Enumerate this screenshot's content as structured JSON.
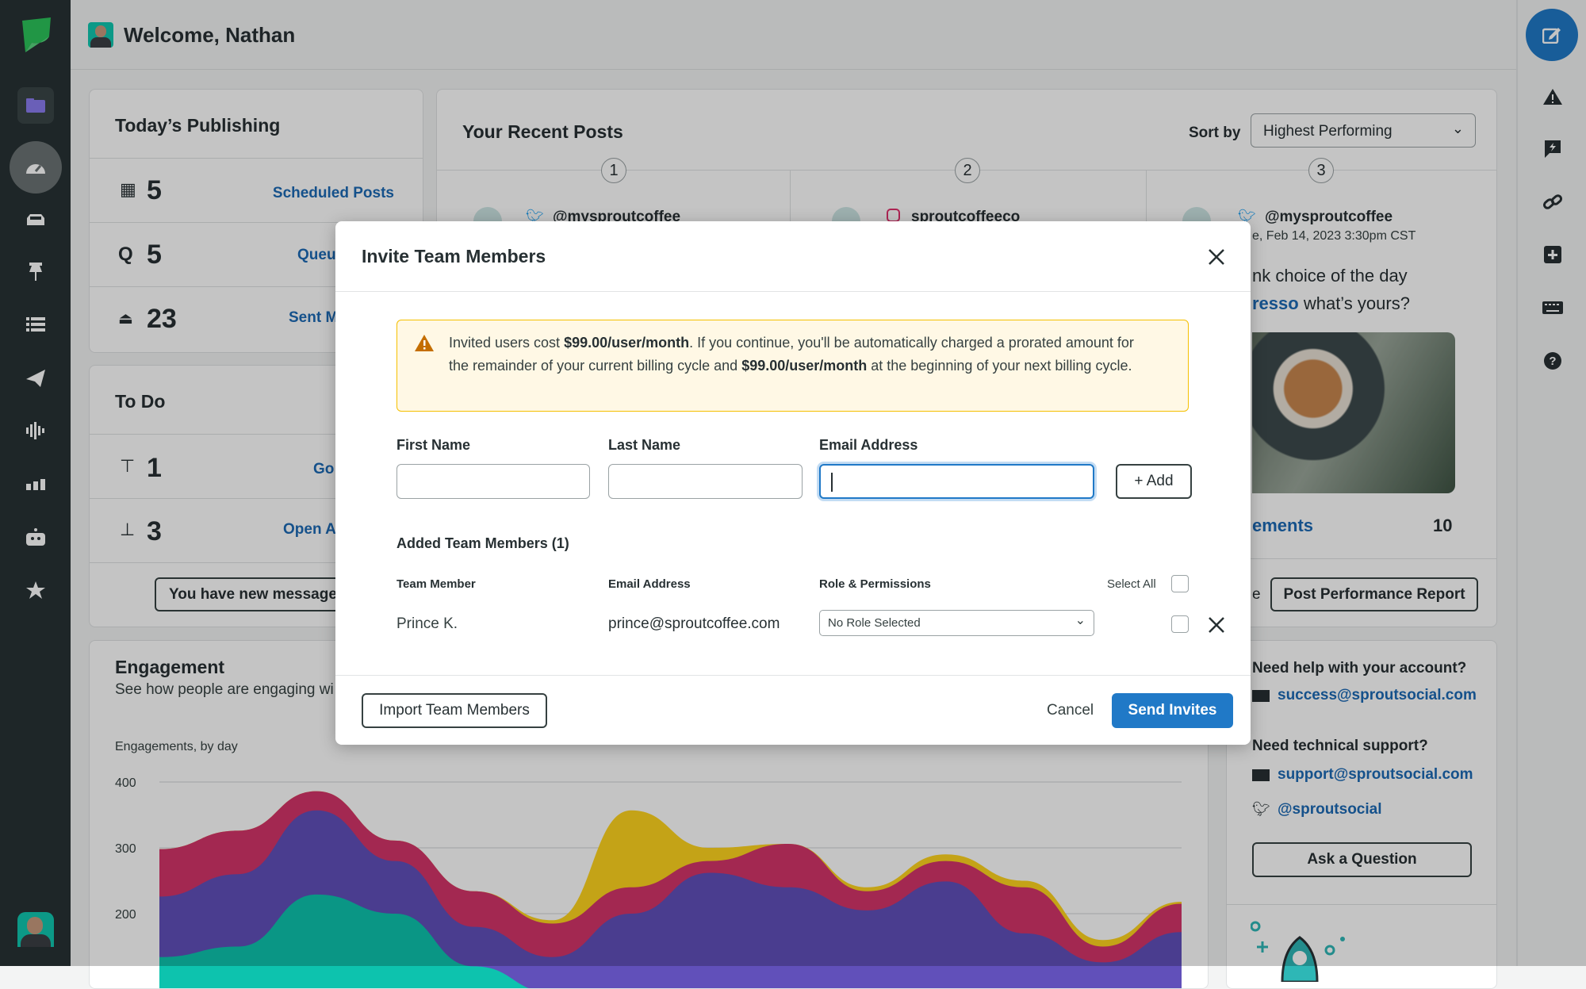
{
  "header": {
    "welcome": "Welcome, Nathan"
  },
  "sidebar": {
    "icons": [
      "sprout-logo",
      "folder-icon",
      "dashboard-icon",
      "inbox-icon",
      "pin-icon",
      "list-icon",
      "send-icon",
      "listening-icon",
      "reports-icon",
      "bot-icon",
      "reviews-icon",
      "user-avatar"
    ]
  },
  "rail": {
    "icons": [
      "compose-icon",
      "alert-icon",
      "feedback-icon",
      "link-icon",
      "add-icon",
      "keyboard-icon",
      "help-icon"
    ]
  },
  "publishing": {
    "title": "Today’s Publishing",
    "rows": [
      {
        "count": "5",
        "link": "Scheduled Posts",
        "icon": "calendar-icon"
      },
      {
        "count": "5",
        "link": "Queu",
        "icon": "queue-icon"
      },
      {
        "count": "23",
        "link": "Sent M",
        "icon": "sent-icon"
      }
    ]
  },
  "todo": {
    "title": "To Do",
    "rows": [
      {
        "count": "1",
        "link": "Go",
        "icon": "pin-icon"
      },
      {
        "count": "3",
        "link": "Open A",
        "icon": "stamp-icon"
      }
    ],
    "messages_button": "You have new messages"
  },
  "recent_posts": {
    "title": "Your Recent Posts",
    "sort_label": "Sort by",
    "sort_value": "Highest Performing",
    "posts": [
      {
        "rank": "1",
        "network": "twitter",
        "handle": "@mysproutcoffee"
      },
      {
        "rank": "2",
        "network": "instagram",
        "handle": "sproutcoffeeco"
      },
      {
        "rank": "3",
        "network": "twitter",
        "handle": "@mysproutcoffee",
        "date": "e, Feb 14, 2023 3:30pm CST",
        "text1": "nk choice of the day",
        "text2_link": "resso",
        "text2": " what’s yours?",
        "metric_label": "ements",
        "metric_value": "10"
      }
    ],
    "left_fragment": "e",
    "report_button": "Post Performance Report"
  },
  "engagement": {
    "title": "Engagement",
    "subtitle": "See how people are engaging wi"
  },
  "chart_data": {
    "type": "area",
    "title": "Engagements, by day",
    "stacked": true,
    "ylim": [
      100,
      400
    ],
    "yticks": [
      "400",
      "300",
      "200"
    ],
    "grid": true,
    "colors": [
      "#0dc3ae",
      "#6150ba",
      "#d4356a",
      "#ffd51e"
    ],
    "series": [
      {
        "values": [
          134,
          150,
          229,
          200,
          120,
          80,
          60,
          50,
          40,
          40,
          40,
          40,
          40,
          40
        ]
      },
      {
        "values": [
          92,
          110,
          128,
          80,
          60,
          54,
          140,
          212,
          200,
          165,
          209,
          130,
          86,
          132
        ]
      },
      {
        "values": [
          72,
          66,
          29,
          31,
          54,
          51,
          40,
          18,
          66,
          29,
          31,
          70,
          24,
          43
        ]
      },
      {
        "values": [
          0,
          0,
          0,
          0,
          0,
          5,
          117,
          20,
          0,
          6,
          10,
          10,
          10,
          3
        ]
      }
    ]
  },
  "help": {
    "q1": "Need help with your account?",
    "email1": "success@sproutsocial.com",
    "q2": "Need technical support?",
    "email2": "support@sproutsocial.com",
    "twitter": "@sproutsocial",
    "ask_button": "Ask a Question"
  },
  "modal": {
    "title": "Invite Team Members",
    "warning": {
      "p1": "Invited users cost ",
      "b1": "$99.00/user/month",
      "p2": ". If you continue, you'll be automatically charged a prorated amount for the remainder of your current billing cycle and ",
      "b2": "$99.00/user/month",
      "p3": " at the beginning of your next billing cycle."
    },
    "first_name_label": "First Name",
    "last_name_label": "Last Name",
    "email_label": "Email Address",
    "first_name_value": "",
    "last_name_value": "",
    "email_value": "",
    "add_button": "+ Add",
    "added_title": "Added Team Members (1)",
    "columns": {
      "member": "Team Member",
      "email": "Email Address",
      "role": "Role & Permissions",
      "select_all": "Select All"
    },
    "members": [
      {
        "name": "Prince K.",
        "email": "prince@sproutcoffee.com",
        "role": "No Role Selected"
      }
    ],
    "import_button": "Import Team Members",
    "cancel_button": "Cancel",
    "send_button": "Send Invites"
  },
  "colors": {
    "accent": "#2079c7",
    "warning_bg": "#fff8e5",
    "warning_border": "#f5c000",
    "link": "#1c6ab5"
  }
}
